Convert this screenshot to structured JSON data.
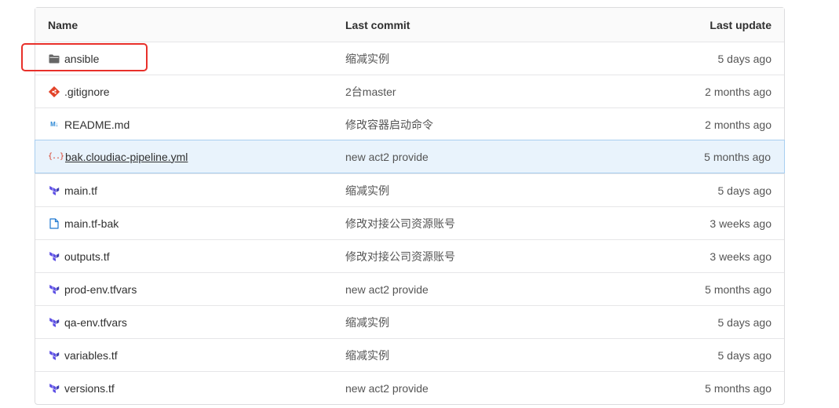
{
  "table": {
    "headers": {
      "name": "Name",
      "last_commit": "Last commit",
      "last_update": "Last update"
    },
    "rows": [
      {
        "name": "ansible",
        "icon": "folder-icon",
        "commit": "缩减实例",
        "updated": "5 days ago"
      },
      {
        "name": ".gitignore",
        "icon": "git-icon",
        "commit": "2台master",
        "updated": "2 months ago"
      },
      {
        "name": "README.md",
        "icon": "markdown-icon",
        "commit": "修改容器启动命令",
        "updated": "2 months ago"
      },
      {
        "name": "bak.cloudiac-pipeline.yml",
        "icon": "yaml-icon",
        "commit": "new act2 provide",
        "updated": "5 months ago",
        "hovered": true
      },
      {
        "name": "main.tf",
        "icon": "terraform-icon",
        "commit": "缩减实例",
        "updated": "5 days ago"
      },
      {
        "name": "main.tf-bak",
        "icon": "file-icon",
        "commit": "修改对接公司资源账号",
        "updated": "3 weeks ago"
      },
      {
        "name": "outputs.tf",
        "icon": "terraform-icon",
        "commit": "修改对接公司资源账号",
        "updated": "3 weeks ago"
      },
      {
        "name": "prod-env.tfvars",
        "icon": "terraform-icon",
        "commit": "new act2 provide",
        "updated": "5 months ago"
      },
      {
        "name": "qa-env.tfvars",
        "icon": "terraform-icon",
        "commit": "缩减实例",
        "updated": "5 days ago"
      },
      {
        "name": "variables.tf",
        "icon": "terraform-icon",
        "commit": "缩减实例",
        "updated": "5 days ago"
      },
      {
        "name": "versions.tf",
        "icon": "terraform-icon",
        "commit": "new act2 provide",
        "updated": "5 months ago"
      }
    ]
  },
  "icons": {
    "yaml_glyph": "{..}",
    "markdown_glyph": "M↓"
  },
  "colors": {
    "highlight_background": "#e9f3fc",
    "annotation_box": "#e8302a",
    "terraform_icon": "#5c4ee5",
    "git_icon": "#e24329",
    "file_icon": "#1f78d1"
  }
}
